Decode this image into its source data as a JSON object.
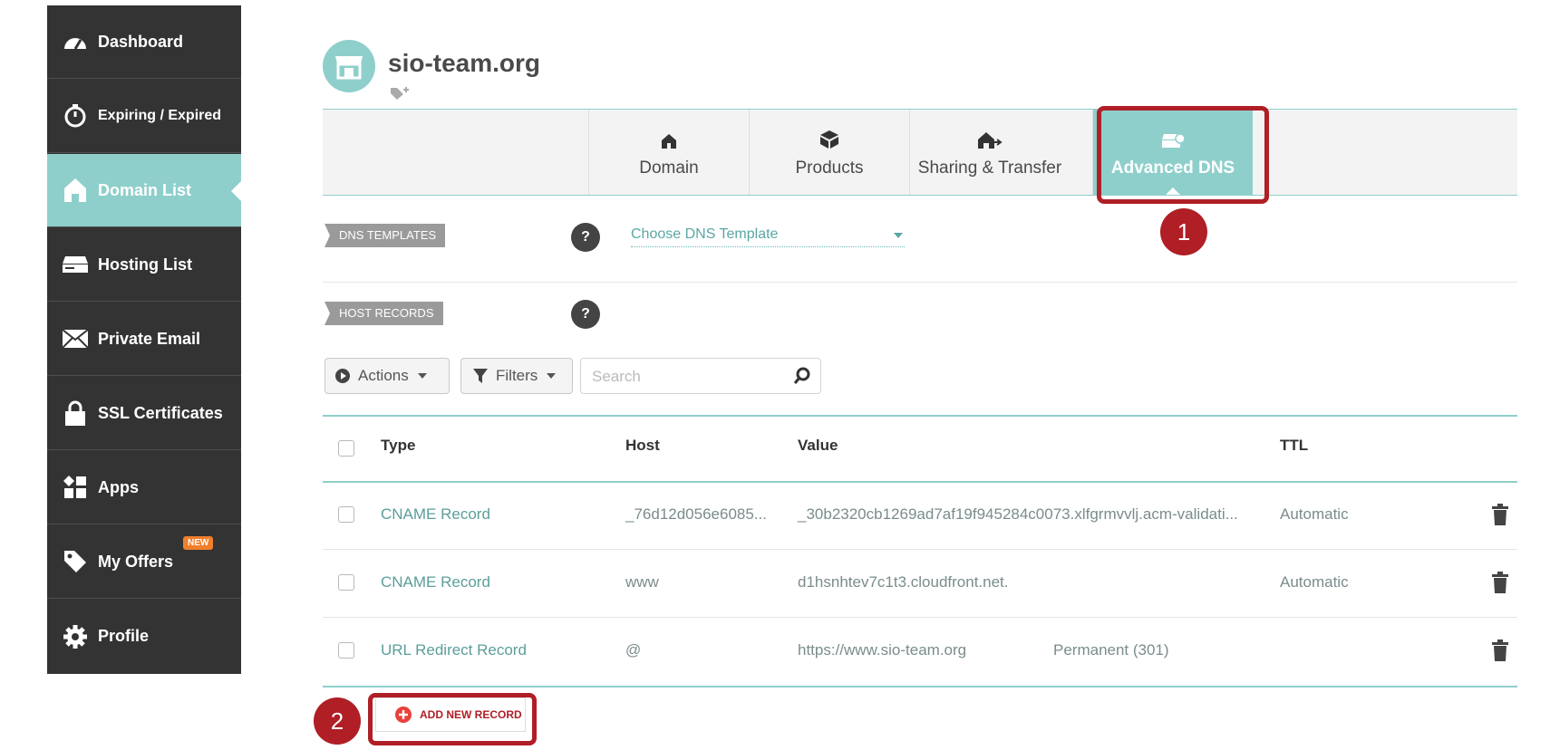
{
  "sidebar": {
    "items": [
      {
        "label": "Dashboard",
        "icon": "speedometer-icon"
      },
      {
        "label": "Expiring / Expired",
        "icon": "timer-icon"
      },
      {
        "label": "Domain List",
        "icon": "home-icon",
        "active": true
      },
      {
        "label": "Hosting List",
        "icon": "server-icon"
      },
      {
        "label": "Private Email",
        "icon": "envelope-icon"
      },
      {
        "label": "SSL Certificates",
        "icon": "lock-icon"
      },
      {
        "label": "Apps",
        "icon": "apps-grid-icon"
      },
      {
        "label": "My Offers",
        "icon": "tag-icon",
        "badge": "NEW"
      },
      {
        "label": "Profile",
        "icon": "gear-icon"
      }
    ]
  },
  "header": {
    "domain": "sio-team.org",
    "icon": "storefront-icon"
  },
  "tabs": [
    {
      "label": "Domain",
      "icon": "home-icon"
    },
    {
      "label": "Products",
      "icon": "box-icon"
    },
    {
      "label": "Sharing & Transfer",
      "icon": "home-arrow-icon"
    },
    {
      "label": "Advanced DNS",
      "icon": "dns-server-icon",
      "active": true
    }
  ],
  "annotations": {
    "step1": "1",
    "step2": "2"
  },
  "dns_templates": {
    "label": "DNS TEMPLATES",
    "select_value": "Choose DNS Template",
    "help": "?"
  },
  "host_records": {
    "label": "HOST RECORDS",
    "help": "?"
  },
  "toolbar": {
    "actions": "Actions",
    "filters": "Filters",
    "search_placeholder": "Search"
  },
  "table": {
    "headers": {
      "type": "Type",
      "host": "Host",
      "value": "Value",
      "ttl": "TTL"
    },
    "rows": [
      {
        "type": "CNAME Record",
        "host": "_76d12d056e6085...",
        "value": "_30b2320cb1269ad7af19f945284c0073.xlfgrmvvlj.acm-validati...",
        "extra": "",
        "ttl": "Automatic"
      },
      {
        "type": "CNAME Record",
        "host": "www",
        "value": "d1hsnhtev7c1t3.cloudfront.net.",
        "extra": "",
        "ttl": "Automatic"
      },
      {
        "type": "URL Redirect Record",
        "host": "@",
        "value": "https://www.sio-team.org",
        "extra": "Permanent (301)",
        "ttl": ""
      }
    ]
  },
  "add_record": {
    "label": "ADD NEW RECORD"
  },
  "colors": {
    "accent": "#8ecfcb",
    "highlight": "#b01e26",
    "sidebar": "#333333",
    "badge": "#f07f2c"
  }
}
